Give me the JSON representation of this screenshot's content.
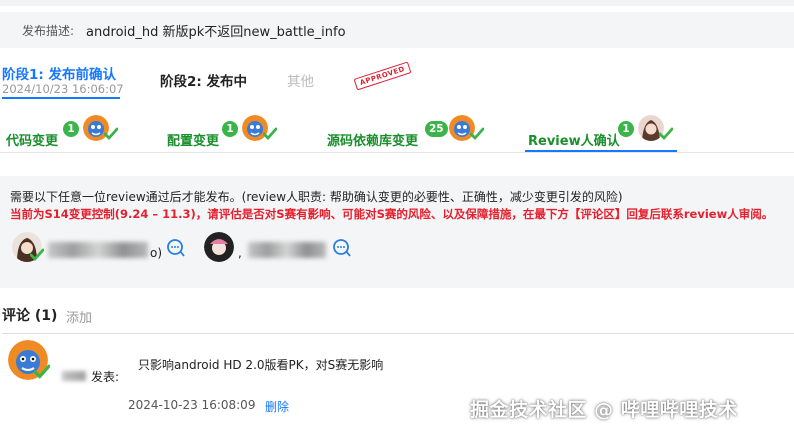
{
  "description": {
    "label": "发布描述:",
    "value": "android_hd 新版pk不返回new_battle_info"
  },
  "stages": [
    {
      "label": "阶段1: 发布前确认",
      "date": "2024/10/23 16:06:07",
      "active": true
    },
    {
      "label": "阶段2: 发布中",
      "active": false
    },
    {
      "label": "其他",
      "active": false
    }
  ],
  "stamp_text": "APPROVED",
  "reviews": [
    {
      "label": "代码变更",
      "count": "1"
    },
    {
      "label": "配置变更",
      "count": "1"
    },
    {
      "label": "源码依赖库变更",
      "count": "25"
    },
    {
      "label": "Review人确认",
      "count": "1"
    }
  ],
  "notice": {
    "line1": "需要以下任意一位review通过后才能发布。(review人职责: 帮助确认变更的必要性、正确性，减少变更引发的风险)",
    "line2": "当前为S14变更控制(9.24 – 11.3)，请评估是否对S赛有影响、可能对S赛的风险、以及保障措施，在最下方【评论区】回复后联系review人审阅。"
  },
  "reviewers": [
    {
      "suffix": "o)"
    },
    {
      "suffix": ","
    }
  ],
  "comments": {
    "title": "评论 (1)",
    "add_label": "添加",
    "items": [
      {
        "posted_label": "发表:",
        "text": "只影响android HD 2.0版看PK，对S赛无影响",
        "time": "2024-10-23 16:08:09",
        "delete_label": "删除"
      }
    ]
  },
  "watermark": "掘金技术社区 @ 哔哩哔哩技术",
  "colors": {
    "accent": "#1677ff",
    "success": "#3bb54a",
    "review_label": "#1a8f2c",
    "warning": "#e5202e"
  }
}
